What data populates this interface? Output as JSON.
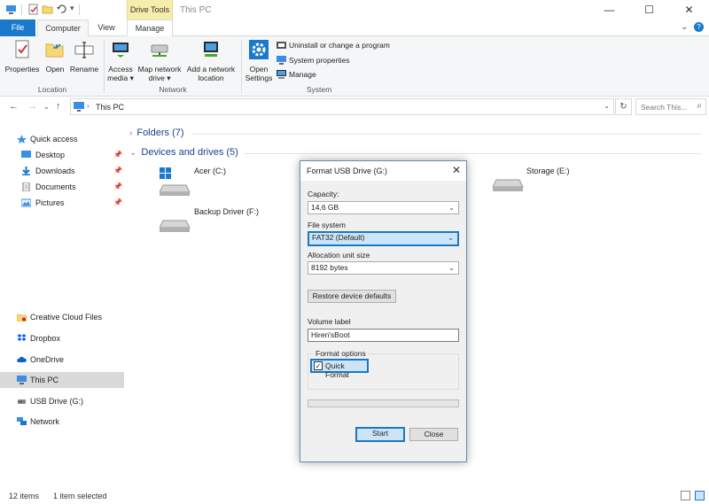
{
  "window": {
    "title": "This PC",
    "contextual_tab": "Drive Tools",
    "controls": {
      "minimize": "—",
      "maximize": "☐",
      "close": "✕"
    }
  },
  "ribbon_tabs": {
    "file": "File",
    "computer": "Computer",
    "view": "View",
    "manage": "Manage"
  },
  "ribbon": {
    "location": {
      "label": "Location",
      "buttons": [
        {
          "label": "Properties",
          "icon": "properties-icon"
        },
        {
          "label": "Open",
          "icon": "open-folder-icon"
        },
        {
          "label": "Rename",
          "icon": "rename-icon"
        }
      ]
    },
    "network": {
      "label": "Network",
      "access_media": [
        "Access",
        "media ▾"
      ],
      "map_drive": [
        "Map network",
        "drive ▾"
      ],
      "add_location": [
        "Add a network",
        "location"
      ]
    },
    "system": {
      "label": "System",
      "open_settings": [
        "Open",
        "Settings"
      ],
      "commands": [
        "Uninstall or change a program",
        "System properties",
        "Manage"
      ]
    }
  },
  "address": {
    "path": "This PC",
    "search_placeholder": "Search This..."
  },
  "sidebar": {
    "quick_access": "Quick access",
    "pinned": [
      "Desktop",
      "Downloads",
      "Documents",
      "Pictures"
    ],
    "pin_glyph": "📌",
    "other": [
      "Creative Cloud Files",
      "Dropbox",
      "OneDrive",
      "This PC",
      "USB Drive (G:)",
      "Network"
    ],
    "selected": "This PC"
  },
  "content": {
    "folders_header": "Folders (7)",
    "devices_header": "Devices and drives (5)",
    "drives": {
      "acer": "Acer (C:)",
      "storage": "Storage (E:)",
      "backup": "Backup Driver (F:)"
    }
  },
  "status": {
    "item_count": "12 items",
    "selection": "1 item selected"
  },
  "dialog": {
    "title": "Format USB Drive (G:)",
    "capacity_label": "Capacity:",
    "capacity_value": "14,6 GB",
    "filesystem_label": "File system",
    "filesystem_value": "FAT32 (Default)",
    "allocation_label": "Allocation unit size",
    "allocation_value": "8192 bytes",
    "restore_button": "Restore device defaults",
    "volume_label": "Volume label",
    "volume_value": "Hiren'sBoot",
    "format_options": "Format options",
    "quick_format": "Quick Format",
    "quick_format_checked": true,
    "progress": 0,
    "start": "Start",
    "close": "Close"
  },
  "colors": {
    "accent": "#1979ca",
    "highlight": "#cce4f7",
    "focus_border": "#1a78c2",
    "contextual_tab": "#f5edaa"
  }
}
